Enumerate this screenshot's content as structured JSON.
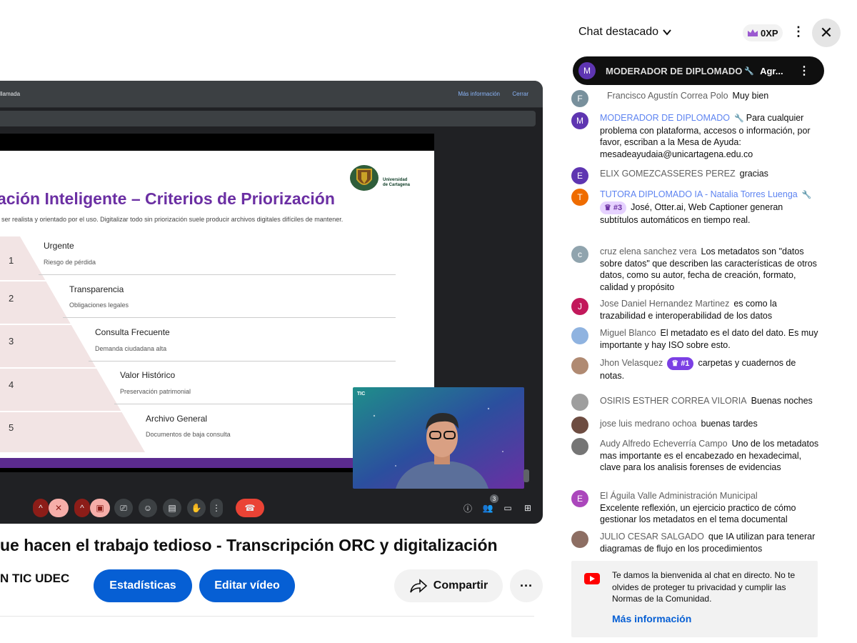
{
  "player": {
    "meet_top_left": "llamada",
    "meet_more_info": "Más información",
    "meet_close": "Cerrar",
    "slide": {
      "title": "ación Inteligente – Criterios de Priorización",
      "subtitle": "ser realista y orientado por el uso. Digitalizar todo sin priorización suele producir archivos digitales difíciles de mantener.",
      "logo_text_line1": "Universidad",
      "logo_text_line2": "de Cartagena",
      "tiers": [
        {
          "num": "1",
          "title": "Urgente",
          "desc": "Riesgo de pérdida"
        },
        {
          "num": "2",
          "title": "Transparencia",
          "desc": "Obligaciones legales"
        },
        {
          "num": "3",
          "title": "Consulta Frecuente",
          "desc": "Demanda ciudadana alta"
        },
        {
          "num": "4",
          "title": "Valor Histórico",
          "desc": "Preservación patrimonial"
        },
        {
          "num": "5",
          "title": "Archivo General",
          "desc": "Documentos de baja consulta"
        }
      ]
    },
    "speaker_logo": "TIC",
    "participants_count": "3"
  },
  "video": {
    "title": "ue hacen el trabajo tedioso - Transcripción ORC y digitalización",
    "channel": "N TIC UDEC",
    "stats_button": "Estadísticas",
    "edit_button": "Editar vídeo",
    "share_button": "Compartir",
    "more_button": "···"
  },
  "chat": {
    "header_title": "Chat destacado",
    "xp": "0XP",
    "pinned": {
      "avatar": "M",
      "author": "MODERADOR DE DIPLOMADO",
      "message": "Agr..."
    },
    "messages": [
      {
        "avatar": "F",
        "author": "Francisco Agustín Correa Polo",
        "text": "Muy bien"
      },
      {
        "avatar": "M",
        "author": "MODERADOR DE DIPLOMADO",
        "text": "Para cualquier problema con plataforma, accesos o información, por favor, escriban a la Mesa de Ayuda: mesadeayudaia@unicartagena.edu.co"
      },
      {
        "avatar": "E",
        "author": "ELIX GOMEZCASSERES PEREZ",
        "text": "gracias"
      },
      {
        "avatar": "T",
        "author": "TUTORA DIPLOMADO IA - Natalia Torres Luenga",
        "badge": "#3",
        "text": "José, Otter.ai, Web Captioner generan subtítulos automáticos en tiempo real."
      },
      {
        "avatar": "c",
        "author": "cruz elena sanchez vera",
        "text": "Los metadatos son \"datos sobre datos\" que describen las características de otros datos, como su autor, fecha de creación, formato, calidad y propósito"
      },
      {
        "avatar": "J",
        "author": "Jose Daniel Hernandez Martinez",
        "text": "es como la trazabilidad e interoperabilidad de los datos"
      },
      {
        "avatar": "",
        "author": "Miguel Blanco",
        "text": "El metadato es el dato del dato. Es muy importante y hay ISO sobre esto."
      },
      {
        "avatar": "",
        "author": "Jhon Velasquez",
        "badge": "#1",
        "text": "carpetas y cuadernos de notas."
      },
      {
        "avatar": "",
        "author": "OSIRIS ESTHER CORREA VILORIA",
        "text": "Buenas noches"
      },
      {
        "avatar": "",
        "author": "jose luis medrano ochoa",
        "text": "buenas tardes"
      },
      {
        "avatar": "",
        "author": "Audy Alfredo Echeverría Campo",
        "text": "Uno de los metadatos mas importante es el encabezado en hexadecimal, clave para los analisis forenses de evidencias"
      },
      {
        "avatar": "E",
        "author": "El Águila Valle Administración Municipal",
        "text": "Excelente reflexión, un ejercicio practico de cómo gestionar los metadatos en el tema documental"
      },
      {
        "avatar": "",
        "author": "JULIO CESAR SALGADO",
        "text": "que IA utilizan para tenerar diagramas de flujo en los procedimientos"
      }
    ],
    "welcome_text": "Te damos la bienvenida al chat en directo. No te olvides de proteger tu privacidad y cumplir las Normas de la Comunidad.",
    "welcome_link": "Más información"
  },
  "colors": {
    "slide_title": "#6b2fa3",
    "yt_blue": "#065fd4",
    "mod_blue": "#5e84f1",
    "meet_red": "#ea4335"
  }
}
